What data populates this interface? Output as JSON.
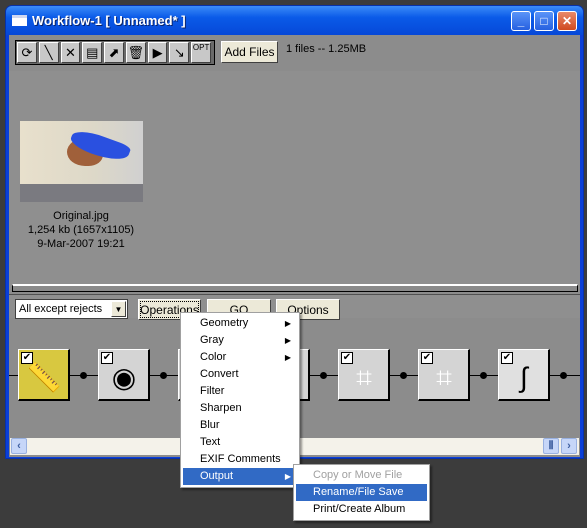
{
  "window": {
    "title": "Workflow-1 [ Unnamed* ]",
    "controls": [
      "minimize",
      "maximize",
      "close"
    ]
  },
  "toolbar": {
    "icons": [
      "refresh-icon",
      "wand-icon",
      "tools-icon",
      "print-icon",
      "export-icon",
      "trash-icon",
      "play-icon",
      "step-icon",
      "opt-down-icon"
    ],
    "opt_label": "OPT",
    "add_files": "Add Files",
    "status": "1 files -- 1.25MB"
  },
  "thumbnail": {
    "name": "Original.jpg",
    "size": "1,254 kb (1657x1105)",
    "date": "9-Mar-2007 19:21"
  },
  "controls": {
    "filter_value": "All except rejects",
    "operations": "Operations",
    "go": "GO",
    "options": "Options"
  },
  "workflow_nodes": [
    {
      "icon": "measure-tape-icon",
      "checked": true
    },
    {
      "icon": "lens-icon",
      "checked": true
    },
    {
      "icon": "operation-icon",
      "checked": true
    },
    {
      "icon": "operation-icon",
      "checked": true
    },
    {
      "icon": "crop-icon",
      "checked": true
    },
    {
      "icon": "crop-icon",
      "checked": true
    },
    {
      "icon": "curves-icon",
      "checked": true
    }
  ],
  "menu": {
    "items": [
      {
        "label": "Geometry",
        "sub": true
      },
      {
        "label": "Gray",
        "sub": true
      },
      {
        "label": "Color",
        "sub": true
      },
      {
        "label": "Convert"
      },
      {
        "label": "Filter"
      },
      {
        "label": "Sharpen"
      },
      {
        "label": "Blur"
      },
      {
        "label": "Text"
      },
      {
        "label": "EXIF Comments"
      },
      {
        "label": "Output",
        "sub": true,
        "highlighted": true
      }
    ]
  },
  "submenu": {
    "items": [
      {
        "label": "Copy or Move File",
        "disabled": true
      },
      {
        "label": "Rename/File Save",
        "highlighted": true
      },
      {
        "label": "Print/Create Album"
      }
    ]
  },
  "colors": {
    "highlight": "#316ac5",
    "titlebar": "#0a5ae8"
  }
}
